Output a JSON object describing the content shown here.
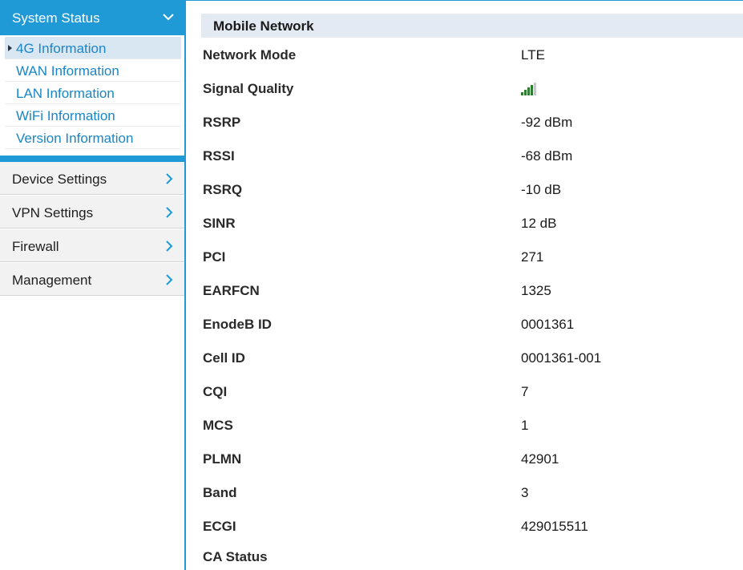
{
  "sidebar": {
    "section_title": "System Status",
    "sub_items": [
      {
        "label": "4G Information",
        "active": true
      },
      {
        "label": "WAN Information",
        "active": false
      },
      {
        "label": "LAN Information",
        "active": false
      },
      {
        "label": "WiFi Information",
        "active": false
      },
      {
        "label": "Version Information",
        "active": false
      }
    ],
    "menu_items": [
      {
        "label": "Device Settings"
      },
      {
        "label": "VPN Settings"
      },
      {
        "label": "Firewall"
      },
      {
        "label": "Management"
      }
    ]
  },
  "panel": {
    "title": "Mobile Network",
    "rows": [
      {
        "key": "Network Mode",
        "value": "LTE"
      },
      {
        "key": "Signal Quality",
        "value": "",
        "signal_bars_filled": 4,
        "signal_bars_total": 5
      },
      {
        "key": "RSRP",
        "value": "-92 dBm"
      },
      {
        "key": "RSSI",
        "value": "-68 dBm"
      },
      {
        "key": "RSRQ",
        "value": "-10 dB"
      },
      {
        "key": "SINR",
        "value": "12 dB"
      },
      {
        "key": "PCI",
        "value": "271"
      },
      {
        "key": "EARFCN",
        "value": "1325"
      },
      {
        "key": "EnodeB ID",
        "value": "0001361"
      },
      {
        "key": "Cell ID",
        "value": "0001361-001"
      },
      {
        "key": "CQI",
        "value": "7"
      },
      {
        "key": "MCS",
        "value": "1"
      },
      {
        "key": "PLMN",
        "value": "42901"
      },
      {
        "key": "Band",
        "value": "3"
      },
      {
        "key": "ECGI",
        "value": "429015511"
      },
      {
        "key": "CA Status",
        "value": ""
      }
    ]
  },
  "colors": {
    "accent": "#1f9ad6",
    "link": "#1a86c8",
    "signal_on": "#2e7d32",
    "signal_off": "#c8c8c8"
  },
  "icons": {
    "section_toggle": "chevron-down-icon",
    "menu_arrow": "chevron-right-icon",
    "active_marker": "caret-right-icon",
    "signal": "signal-bars-icon"
  }
}
